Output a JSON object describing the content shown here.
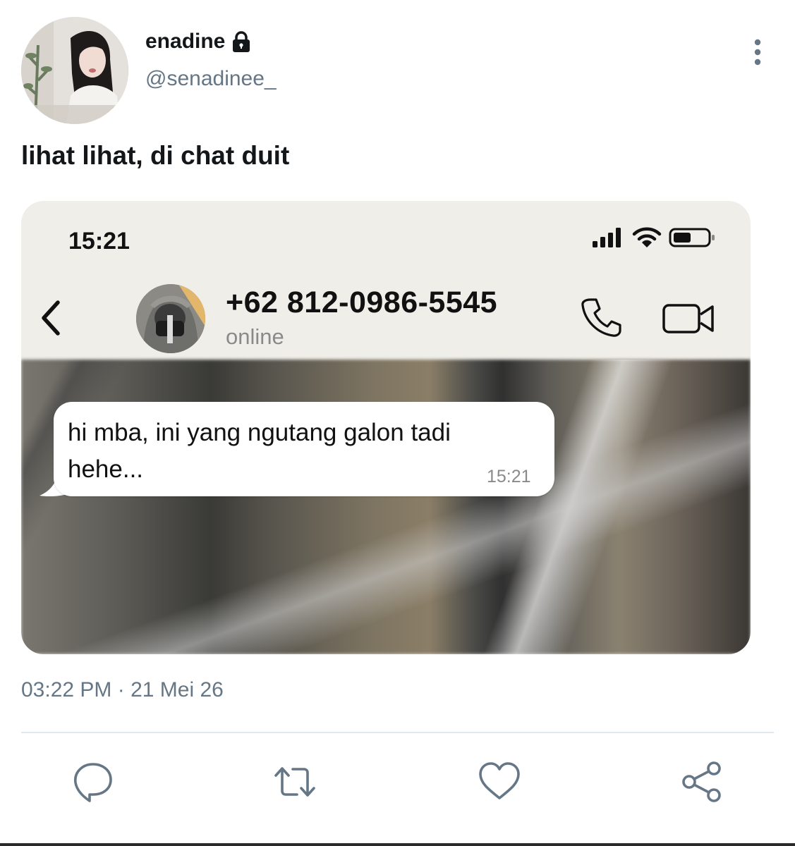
{
  "author": {
    "display_name": "enadine",
    "handle": "@senadinee_",
    "protected_icon": "lock-icon",
    "avatar": "profile-photo"
  },
  "tweet": {
    "text": "lihat lihat, di chat duit",
    "timestamp": "03:22 PM · 21 Mei 26"
  },
  "media": {
    "status_bar": {
      "time": "15:21",
      "icons": [
        "signal-icon",
        "wifi-icon",
        "battery-icon"
      ]
    },
    "chat_header": {
      "contact_number": "+62 812-0986-5545",
      "contact_status": "online",
      "icons": [
        "back-icon",
        "call-icon",
        "video-call-icon"
      ]
    },
    "message": {
      "line1": "hi mba, ini yang ngutang galon tadi",
      "line2": "hehe...",
      "time": "15:21"
    }
  },
  "actions": [
    {
      "name": "reply",
      "icon": "reply-icon"
    },
    {
      "name": "retweet",
      "icon": "retweet-icon"
    },
    {
      "name": "like",
      "icon": "heart-icon"
    },
    {
      "name": "share",
      "icon": "share-icon"
    }
  ],
  "colors": {
    "text_primary": "#14171a",
    "text_secondary": "#657786",
    "divider": "#e1e8ed",
    "chat_header_bg": "#efeee9",
    "bubble_bg": "#ffffff"
  }
}
